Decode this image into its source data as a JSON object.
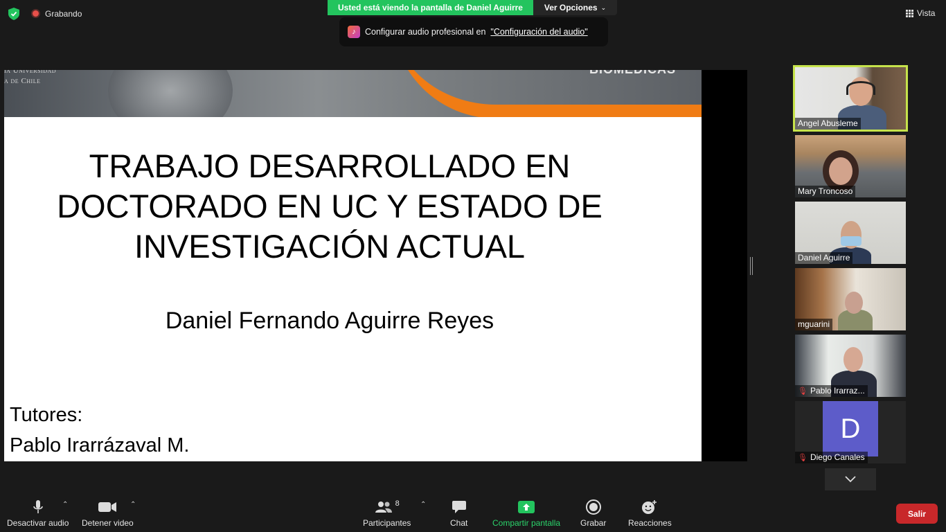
{
  "top_bar": {
    "recording_label": "Grabando",
    "share_banner": "Usted está viendo la pantalla de Daniel Aguirre",
    "view_options": "Ver Opciones",
    "audio_tip_text": "Configurar audio profesional en",
    "audio_tip_link": "\"Configuración del audio\"",
    "view_label": "Vista"
  },
  "slide": {
    "header_univ_line1": "ia Universidad",
    "header_univ_line2": "a de Chile",
    "header_right": "BIOMEDICAS",
    "title_line1": "TRABAJO DESARROLLADO EN",
    "title_line2": "DOCTORADO EN UC Y ESTADO DE",
    "title_line3": "INVESTIGACIÓN ACTUAL",
    "author": "Daniel Fernando Aguirre Reyes",
    "tutors_label": "Tutores:",
    "tutor1": "Pablo Irarrázaval M."
  },
  "participants": [
    {
      "name": "Angel Abusleme",
      "muted": false,
      "active": true
    },
    {
      "name": "Mary Troncoso",
      "muted": false,
      "active": false
    },
    {
      "name": "Daniel Aguirre",
      "muted": false,
      "active": false
    },
    {
      "name": "mguarini",
      "muted": false,
      "active": false
    },
    {
      "name": "Pablo Irarraz...",
      "muted": true,
      "active": false
    },
    {
      "name": "Diego Canales",
      "muted": true,
      "active": false,
      "initial": "D"
    }
  ],
  "toolbar": {
    "mute_label": "Desactivar audio",
    "video_label": "Detener video",
    "participants_label": "Participantes",
    "participants_count": "8",
    "chat_label": "Chat",
    "share_label": "Compartir pantalla",
    "record_label": "Grabar",
    "reactions_label": "Reacciones",
    "leave_label": "Salir"
  },
  "colors": {
    "share_green": "#23c45e",
    "active_speaker": "#c6e34b",
    "leave_red": "#c8282a",
    "avatar_purple": "#5d5cc9"
  }
}
